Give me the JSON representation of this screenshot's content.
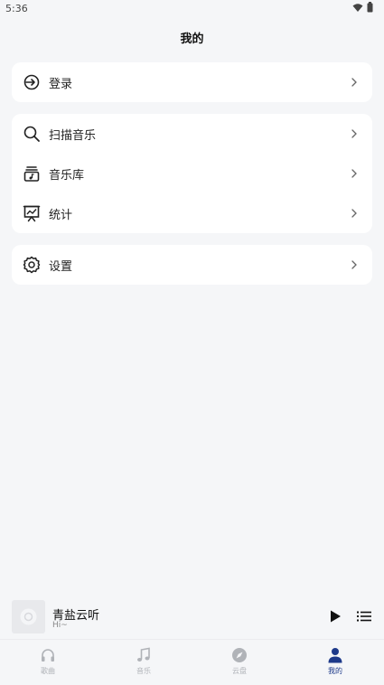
{
  "status": {
    "time": "5:36"
  },
  "header": {
    "title": "我的"
  },
  "groups": [
    [
      {
        "label": "登录",
        "icon": "login-icon"
      }
    ],
    [
      {
        "label": "扫描音乐",
        "icon": "search-icon"
      },
      {
        "label": "音乐库",
        "icon": "music-library-icon"
      },
      {
        "label": "统计",
        "icon": "statistics-icon"
      }
    ],
    [
      {
        "label": "设置",
        "icon": "gear-icon"
      }
    ]
  ],
  "player": {
    "title": "青盐云听",
    "subtitle": "Hi~"
  },
  "tabs": [
    {
      "label": "歌曲",
      "icon": "headphones-icon"
    },
    {
      "label": "音乐",
      "icon": "music-note-icon"
    },
    {
      "label": "云盘",
      "icon": "compass-icon"
    },
    {
      "label": "我的",
      "icon": "person-icon",
      "active": true
    }
  ],
  "colors": {
    "accent": "#1e3a8a",
    "background": "#f5f6f8",
    "card": "#ffffff"
  }
}
